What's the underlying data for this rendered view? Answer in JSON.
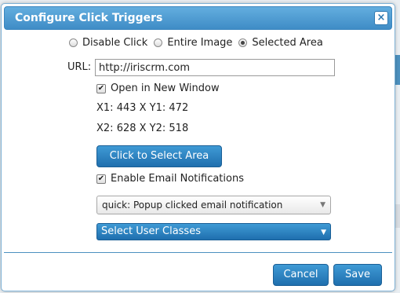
{
  "dialog": {
    "title": "Configure Click Triggers",
    "close_label": "×",
    "radios": [
      {
        "label": "Disable Click",
        "checked": false
      },
      {
        "label": "Entire Image",
        "checked": false
      },
      {
        "label": "Selected Area",
        "checked": true
      }
    ],
    "url_label": "URL:",
    "url_value": "http://iriscrm.com",
    "open_new_window": {
      "label": "Open in New Window",
      "checked": true
    },
    "coords": {
      "first": "X1: 443 X Y1: 472",
      "second": "X2: 628 X Y2: 518"
    },
    "select_area_button": "Click to Select Area",
    "email_notifications": {
      "label": "Enable Email Notifications",
      "checked": true
    },
    "notification_select": {
      "value": "quick: Popup clicked email notification"
    },
    "user_classes": {
      "value": "Select User Classes"
    },
    "buttons": {
      "cancel": "Cancel",
      "save": "Save"
    }
  },
  "icons": {
    "check": "check-icon",
    "dropdown": "chevron-down-icon",
    "close": "close-icon"
  },
  "colors": {
    "accent": "#2f86c6",
    "title_bar": "#4c9ad2"
  }
}
